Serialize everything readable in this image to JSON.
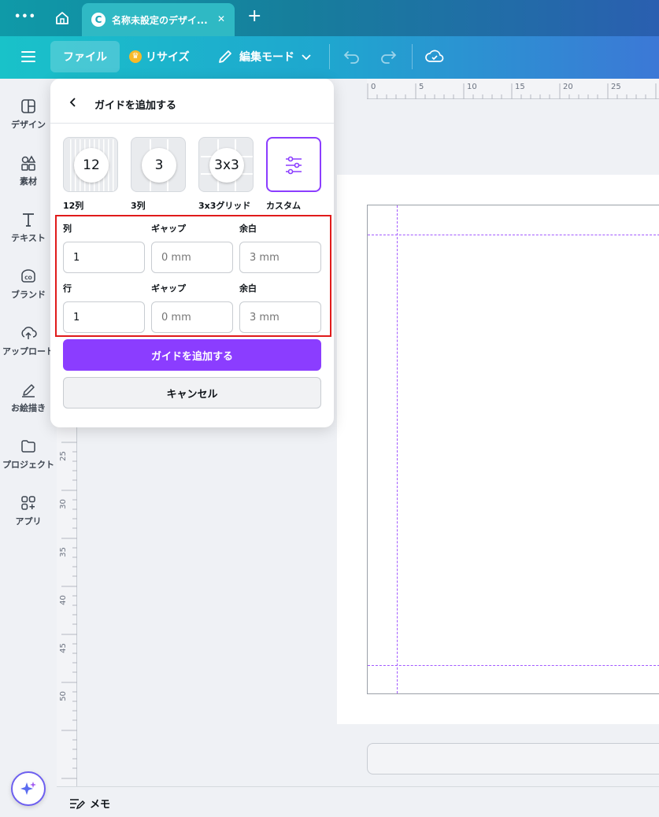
{
  "tabbar": {
    "more_label": "•••",
    "tab_title": "名称未設定のデザイ...",
    "close_label": "✕",
    "new_tab_label": "+"
  },
  "toolbar": {
    "file_label": "ファイル",
    "resize_label": "リサイズ",
    "edit_mode_label": "編集モード"
  },
  "sidebar": {
    "items": [
      {
        "label": "デザイン",
        "icon": "design-icon"
      },
      {
        "label": "素材",
        "icon": "elements-icon"
      },
      {
        "label": "テキスト",
        "icon": "text-icon"
      },
      {
        "label": "ブランド",
        "icon": "brand-icon"
      },
      {
        "label": "アップロード",
        "icon": "upload-icon"
      },
      {
        "label": "お絵描き",
        "icon": "draw-icon"
      },
      {
        "label": "プロジェクト",
        "icon": "folder-icon"
      },
      {
        "label": "アプリ",
        "icon": "apps-icon"
      }
    ]
  },
  "ruler": {
    "top_ticks": [
      "0",
      "5",
      "10",
      "15",
      "20",
      "25"
    ],
    "left_ticks": [
      "25",
      "30",
      "35",
      "40",
      "45",
      "50"
    ]
  },
  "panel": {
    "title": "ガイドを追加する",
    "presets": [
      {
        "badge": "12",
        "label": "12列"
      },
      {
        "badge": "3",
        "label": "3列"
      },
      {
        "badge": "3x3",
        "label": "3x3グリッド"
      },
      {
        "badge": "",
        "label": "カスタム"
      }
    ],
    "columns": {
      "label": "列",
      "gap_label": "ギャップ",
      "margin_label": "余白",
      "count": "1",
      "gap_placeholder": "0 mm",
      "margin_placeholder": "3 mm"
    },
    "rows": {
      "label": "行",
      "gap_label": "ギャップ",
      "margin_label": "余白",
      "count": "1",
      "gap_placeholder": "0 mm",
      "margin_placeholder": "3 mm"
    },
    "add_button": "ガイドを追加する",
    "cancel_button": "キャンセル"
  },
  "bottom": {
    "notes_label": "メモ"
  },
  "colors": {
    "accent": "#8b3dff",
    "highlight": "#e01b1b",
    "guide": "#a259ff"
  }
}
